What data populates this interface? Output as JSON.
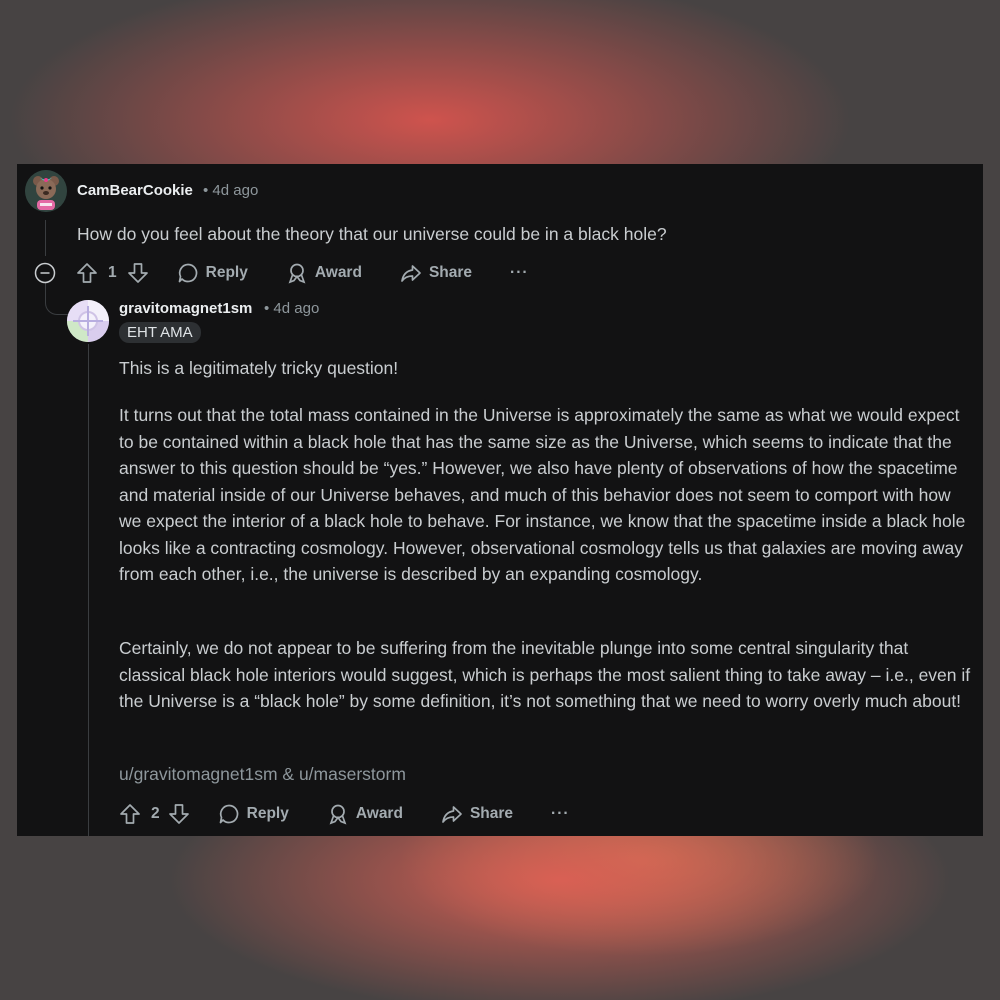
{
  "comment": {
    "username": "CamBearCookie",
    "time": "• 4d ago",
    "body": "How do you feel about the theory that our universe could be in a black hole?",
    "vote_count": "1",
    "actions": {
      "reply": "Reply",
      "award": "Award",
      "share": "Share",
      "more": "···"
    }
  },
  "reply": {
    "username": "gravitomagnet1sm",
    "time": "• 4d ago",
    "flair": "EHT AMA",
    "paragraphs": [
      "This is a legitimately tricky question!",
      "It turns out that the total mass contained in the Universe is approximately the same as what we would expect to be contained within a black hole that has the same size as the Universe, which seems to indicate that the answer to this question should be “yes.”  However, we also have plenty of observations of how the spacetime and material inside of our Universe behaves, and much of this behavior does not seem to comport with how we expect the interior of a black hole to behave.  For instance, we know that the spacetime inside a black hole looks like a contracting cosmology. However, observational cosmology tells us that galaxies are moving away from each other, i.e., the universe is described by an expanding cosmology.",
      "Certainly, we do not appear to be suffering from the inevitable plunge into some central singularity that classical black hole interiors would suggest, which is perhaps the most salient thing to take away – i.e., even if the Universe is a “black hole” by some definition, it’s not something that we need to worry overly much about!",
      "u/gravitomagnet1sm & u/maserstorm"
    ],
    "vote_count": "2",
    "actions": {
      "reply": "Reply",
      "award": "Award",
      "share": "Share",
      "more": "···"
    }
  }
}
